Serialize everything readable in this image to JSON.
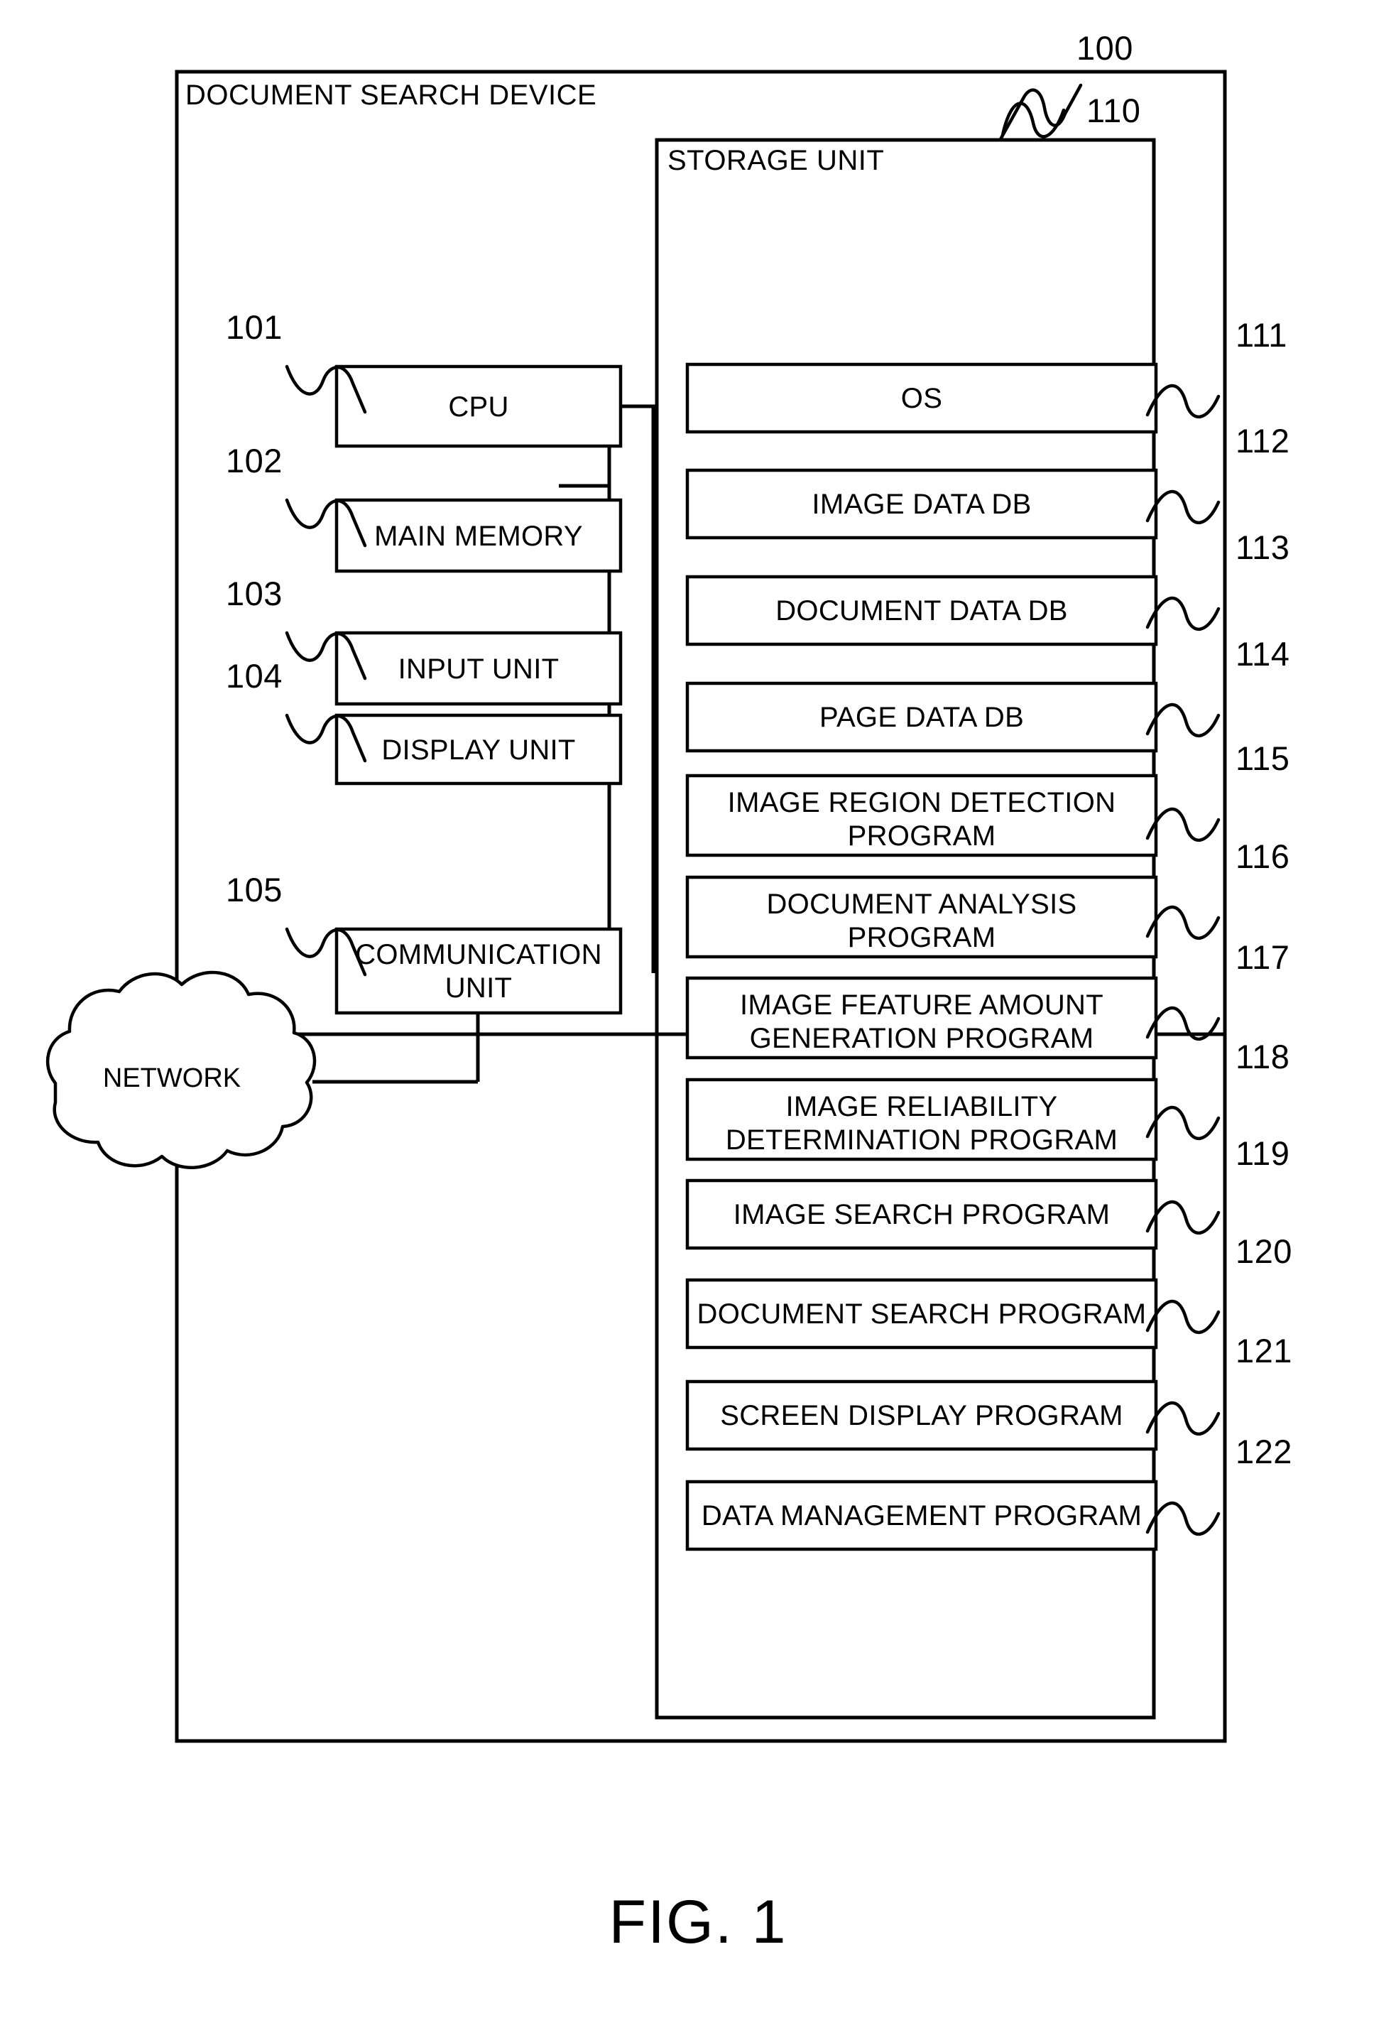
{
  "figure": {
    "caption": "FIG. 1",
    "device_title": "DOCUMENT SEARCH DEVICE",
    "device_ref": "100",
    "storage_title": "STORAGE UNIT",
    "storage_ref": "110",
    "network_label": "NETWORK"
  },
  "hardware": [
    {
      "ref": "101",
      "label": "CPU"
    },
    {
      "ref": "102",
      "label": "MAIN MEMORY"
    },
    {
      "ref": "103",
      "label": "INPUT UNIT"
    },
    {
      "ref": "104",
      "label": "DISPLAY UNIT"
    },
    {
      "ref": "105",
      "label": "COMMUNICATION",
      "label2": "UNIT"
    }
  ],
  "storage_items": [
    {
      "ref": "111",
      "line1": "OS",
      "line2": ""
    },
    {
      "ref": "112",
      "line1": "IMAGE DATA DB",
      "line2": ""
    },
    {
      "ref": "113",
      "line1": "DOCUMENT DATA DB",
      "line2": ""
    },
    {
      "ref": "114",
      "line1": "PAGE DATA DB",
      "line2": ""
    },
    {
      "ref": "115",
      "line1": "IMAGE REGION DETECTION",
      "line2": "PROGRAM"
    },
    {
      "ref": "116",
      "line1": "DOCUMENT ANALYSIS",
      "line2": "PROGRAM"
    },
    {
      "ref": "117",
      "line1": "IMAGE FEATURE AMOUNT",
      "line2": "GENERATION PROGRAM"
    },
    {
      "ref": "118",
      "line1": "IMAGE RELIABILITY",
      "line2": "DETERMINATION PROGRAM"
    },
    {
      "ref": "119",
      "line1": "IMAGE SEARCH PROGRAM",
      "line2": ""
    },
    {
      "ref": "120",
      "line1": "DOCUMENT SEARCH PROGRAM",
      "line2": ""
    },
    {
      "ref": "121",
      "line1": "SCREEN DISPLAY PROGRAM",
      "line2": ""
    },
    {
      "ref": "122",
      "line1": "DATA MANAGEMENT PROGRAM",
      "line2": ""
    }
  ],
  "colors": {
    "ink": "#000000",
    "paper": "#ffffff"
  }
}
